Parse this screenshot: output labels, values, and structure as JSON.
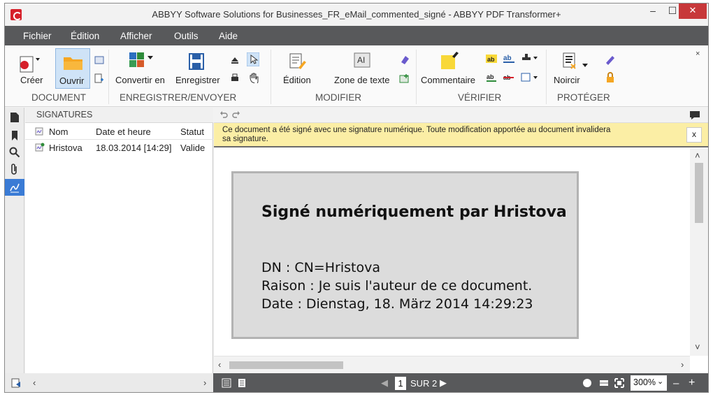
{
  "window": {
    "title": "ABBYY Software Solutions for Businesses_FR_eMail_commented_signé - ABBYY PDF Transformer+",
    "minimize": "–",
    "maximize": "☐",
    "close": "✕"
  },
  "menu": [
    "Fichier",
    "Édition",
    "Afficher",
    "Outils",
    "Aide"
  ],
  "ribbon": {
    "creer": "Créer",
    "ouvrir": "Ouvrir",
    "convertir": "Convertir en",
    "enregistrer": "Enregistrer",
    "edition": "Édition",
    "zone_texte": "Zone de texte",
    "commentaire": "Commentaire",
    "noircir": "Noircir",
    "groups": {
      "document": "DOCUMENT",
      "enregistrer_envoyer": "ENREGISTRER/ENVOYER",
      "modifier": "MODIFIER",
      "verifier": "VÉRIFIER",
      "proteger": "PROTÉGER"
    },
    "close": "×"
  },
  "signatures_panel": {
    "header": "SIGNATURES",
    "columns": [
      "Nom",
      "Date et heure",
      "Statut"
    ],
    "rows": [
      {
        "nom": "Hristova",
        "date": "18.03.2014 [14:29]",
        "statut": "Valide"
      }
    ]
  },
  "document": {
    "notice": "Ce document a été signé avec une signature numérique. Toute modification apportée au document invalidera sa signature.",
    "notice_close": "x",
    "signature": {
      "title": "Signé numériquement par Hristova",
      "dn": "DN : CN=Hristova",
      "raison": "Raison : Je suis l'auteur de ce document.",
      "date": "Date : Dienstag, 18. März 2014 14:29:23"
    }
  },
  "statusbar": {
    "page_current": "1",
    "page_of": "SUR 2",
    "zoom": "300%",
    "zoom_out": "–",
    "zoom_in": "+"
  },
  "colors": {
    "menubar": "#58595b",
    "accent_red": "#d6202a",
    "notice_bg": "#fbeea5",
    "folder_orange": "#f5a623",
    "sticky_yellow": "#f8d838"
  },
  "icons": [
    "app-icon",
    "create-pdf-icon",
    "open-folder-icon",
    "convert-office-icon",
    "save-disk-icon",
    "edit-icon",
    "text-box-icon",
    "comment-icon",
    "redact-icon",
    "lock-icon",
    "signature-icon",
    "search-icon",
    "attachment-icon",
    "bookmark-icon",
    "page-icon"
  ]
}
